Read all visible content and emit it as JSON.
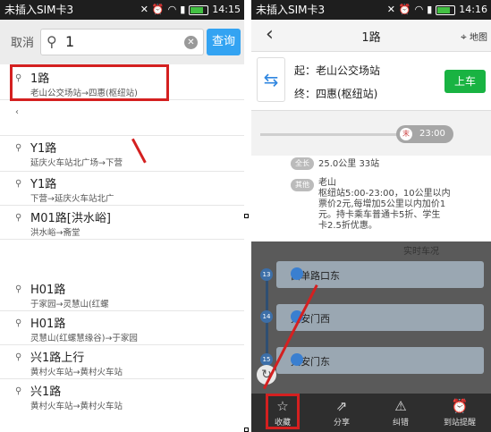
{
  "status": {
    "carrier": "未插入SIM卡3",
    "time": "14:15",
    "time_right": "14:16"
  },
  "left": {
    "cancel_label": "取消",
    "search_value": "1",
    "search_button": "查询",
    "results": [
      {
        "title": "1路",
        "sub": "老山公交场站→四惠(枢纽站)"
      },
      {
        "title": "Y1路",
        "sub": "延庆火车站北广场→下营"
      },
      {
        "title": "Y1路",
        "sub": "下营→延庆火车站北广"
      },
      {
        "title": "M01路[洪水峪]",
        "sub": "洪水峪→斋堂"
      },
      {
        "title": "H01路",
        "sub": "于家园→灵慧山(红螺"
      },
      {
        "title": "H01路",
        "sub": "灵慧山(红螺慧缘谷)→于家园"
      },
      {
        "title": "兴1路上行",
        "sub": "黄村火车站→黄村火车站"
      },
      {
        "title": "兴1路",
        "sub": "黄村火车站→黄村火车站"
      }
    ]
  },
  "right": {
    "title": "1路",
    "map_label": "地图",
    "from_label": "起：老山公交场站",
    "to_label": "终：四惠(枢纽站)",
    "board_button": "上车",
    "time_tag": "末",
    "time_value": "23:00",
    "length_tag": "全长",
    "length_text": "25.0公里 33站",
    "other_tag": "其他",
    "other_lines": [
      "老山",
      "枢纽站5:00-23:00，10公里以内",
      "票价2元,每增加5公里以内加价1",
      "元。持卡乘车普通卡5折、学生",
      "卡2.5折优惠。"
    ],
    "banner_text": "实时车况",
    "stops": [
      {
        "num": "13",
        "name": "西单路口东"
      },
      {
        "num": "14",
        "name": "天安门西"
      },
      {
        "num": "15",
        "name": "天安门东"
      }
    ],
    "toolbar": [
      {
        "icon": "star-icon",
        "label": "收藏"
      },
      {
        "icon": "share-icon",
        "label": "分享"
      },
      {
        "icon": "warning-icon",
        "label": "纠错"
      },
      {
        "icon": "alarm-icon",
        "label": "到站提醒"
      }
    ]
  }
}
